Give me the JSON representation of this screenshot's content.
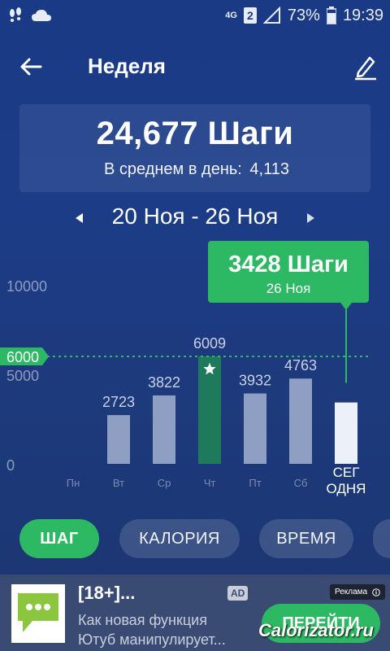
{
  "status_bar": {
    "network": "4G",
    "sim": "2",
    "battery": "73%",
    "time": "19:39"
  },
  "header": {
    "title": "Неделя"
  },
  "summary": {
    "total": "24,677 Шаги",
    "average_label": "В среднем в день:",
    "average_value": "4,113"
  },
  "date_nav": {
    "range": "20 Ноя - 26 Ноя"
  },
  "chart_data": {
    "type": "bar",
    "categories": [
      "Пн",
      "Вт",
      "Ср",
      "Чт",
      "Пт",
      "Сб",
      "СЕГОДНЯ"
    ],
    "category_lines": [
      [
        "Пн"
      ],
      [
        "Вт"
      ],
      [
        "Ср"
      ],
      [
        "Чт"
      ],
      [
        "Пт"
      ],
      [
        "Сб"
      ],
      [
        "СЕГ",
        "ОДНЯ"
      ]
    ],
    "values": [
      0,
      2723,
      3822,
      6009,
      3932,
      4763,
      3428
    ],
    "value_labels": [
      "",
      "2723",
      "3822",
      "6009",
      "3932",
      "4763",
      ""
    ],
    "ylim": [
      0,
      10000
    ],
    "yticks": [
      0,
      5000,
      10000
    ],
    "goal": 6000,
    "goal_label": "6000",
    "goal_reached_index": 3,
    "selected_index": 6,
    "tooltip": {
      "value": "3428 Шаги",
      "date": "26 Ноя"
    },
    "colors": {
      "bar": "#8f9fc4",
      "goal_bar": "#1f7a5c",
      "selected_bar": "#ecf0f8",
      "goal_line": "#2db863",
      "tooltip": "#2db863"
    }
  },
  "tabs": [
    {
      "label": "ШАГ",
      "active": true
    },
    {
      "label": "КАЛОРИЯ",
      "active": false
    },
    {
      "label": "ВРЕМЯ",
      "active": false
    },
    {
      "label": "",
      "active": false
    }
  ],
  "ad": {
    "title": "[18+]...",
    "badge": "AD",
    "label": "Реклама",
    "line1": "Как новая функция",
    "line2": "Ютуб манипулирует...",
    "cta": "ПЕРЕЙТИ"
  },
  "watermark": "Calorizator.ru"
}
